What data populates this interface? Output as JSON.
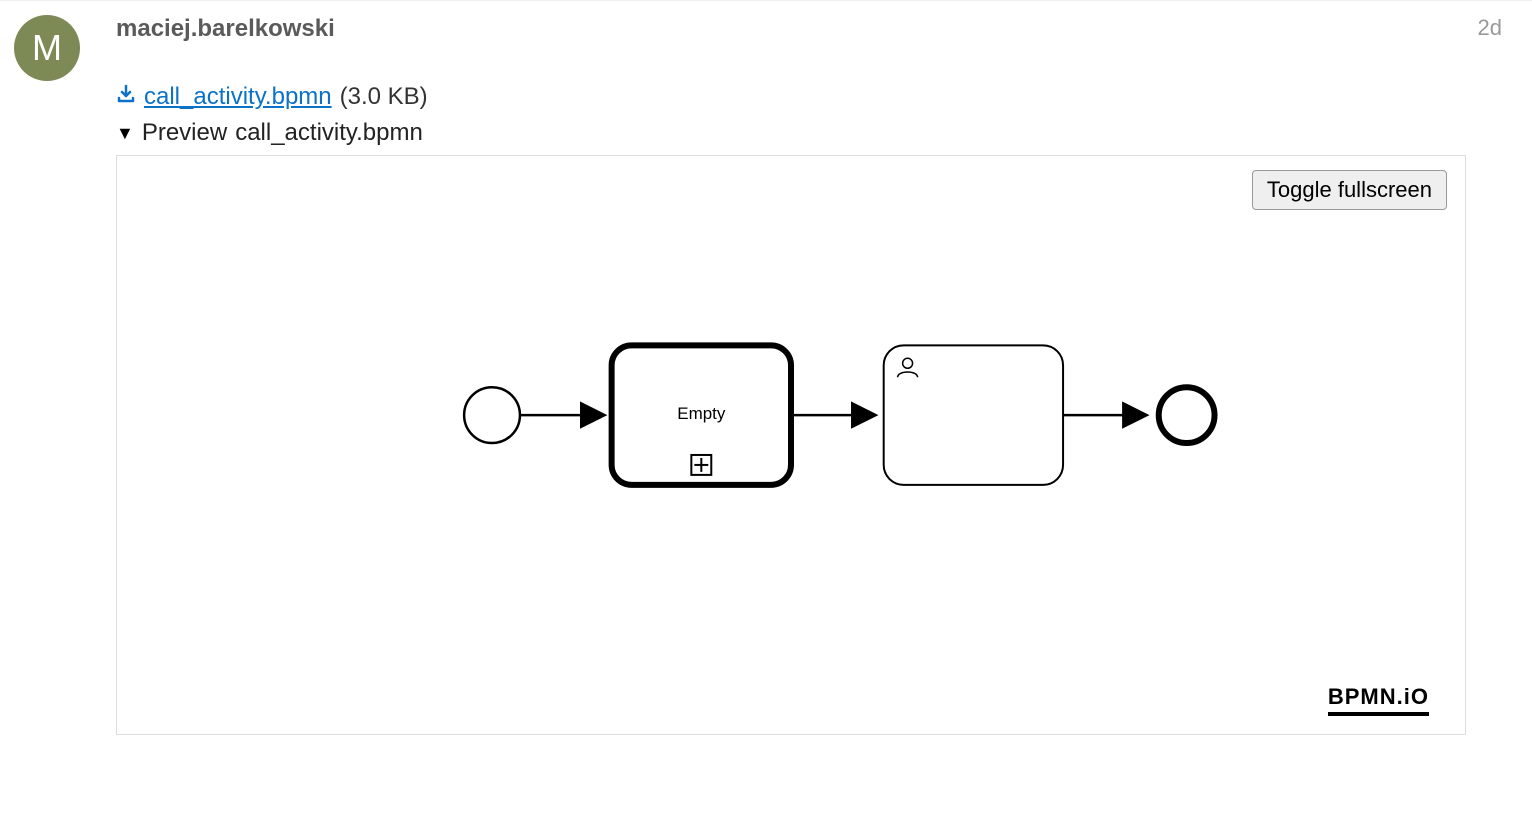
{
  "post": {
    "avatar_letter": "M",
    "username": "maciej.barelkowski",
    "age": "2d"
  },
  "attachment": {
    "filename": "call_activity.bpmn",
    "size_label": "(3.0 KB)"
  },
  "preview": {
    "label_prefix": "Preview",
    "filename": "call_activity.bpmn",
    "toggle_label": "Toggle fullscreen",
    "brand": "BPMN.iO"
  },
  "diagram": {
    "start_event": "",
    "call_activity_label": "Empty",
    "user_task_label": "",
    "end_event": ""
  }
}
